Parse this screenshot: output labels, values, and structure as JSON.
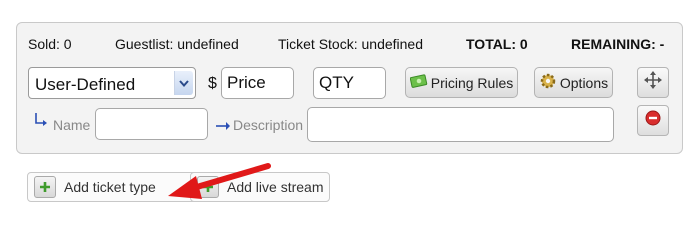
{
  "stats": {
    "sold": "Sold:  0",
    "guestlist": "Guestlist:  undefined",
    "ticket_stock": "Ticket Stock:  undefined",
    "total": "TOTAL:  0",
    "remaining": "REMAINING:  -"
  },
  "ticket_row": {
    "type_select": {
      "value": "User-Defined"
    },
    "currency": "$",
    "price_placeholder": "Price",
    "qty_placeholder": "QTY",
    "pricing_rules_label": "Pricing Rules",
    "options_label": "Options"
  },
  "details_row": {
    "name_label": "Name",
    "description_label": "Description"
  },
  "actions": {
    "add_ticket_type": "Add ticket type",
    "add_live_stream": "Add live stream"
  },
  "icons": [
    "return-arrow-icon",
    "right-arrow-icon",
    "money-icon",
    "gear-icon",
    "move-arrows-icon",
    "remove-icon",
    "plus-icon",
    "chevron-down-icon"
  ],
  "colors": {
    "arrow_annotation": "#e01818",
    "remove_red": "#d92d2d",
    "plus_green": "#3f9b2c",
    "link_blue": "#2a4fb5"
  }
}
